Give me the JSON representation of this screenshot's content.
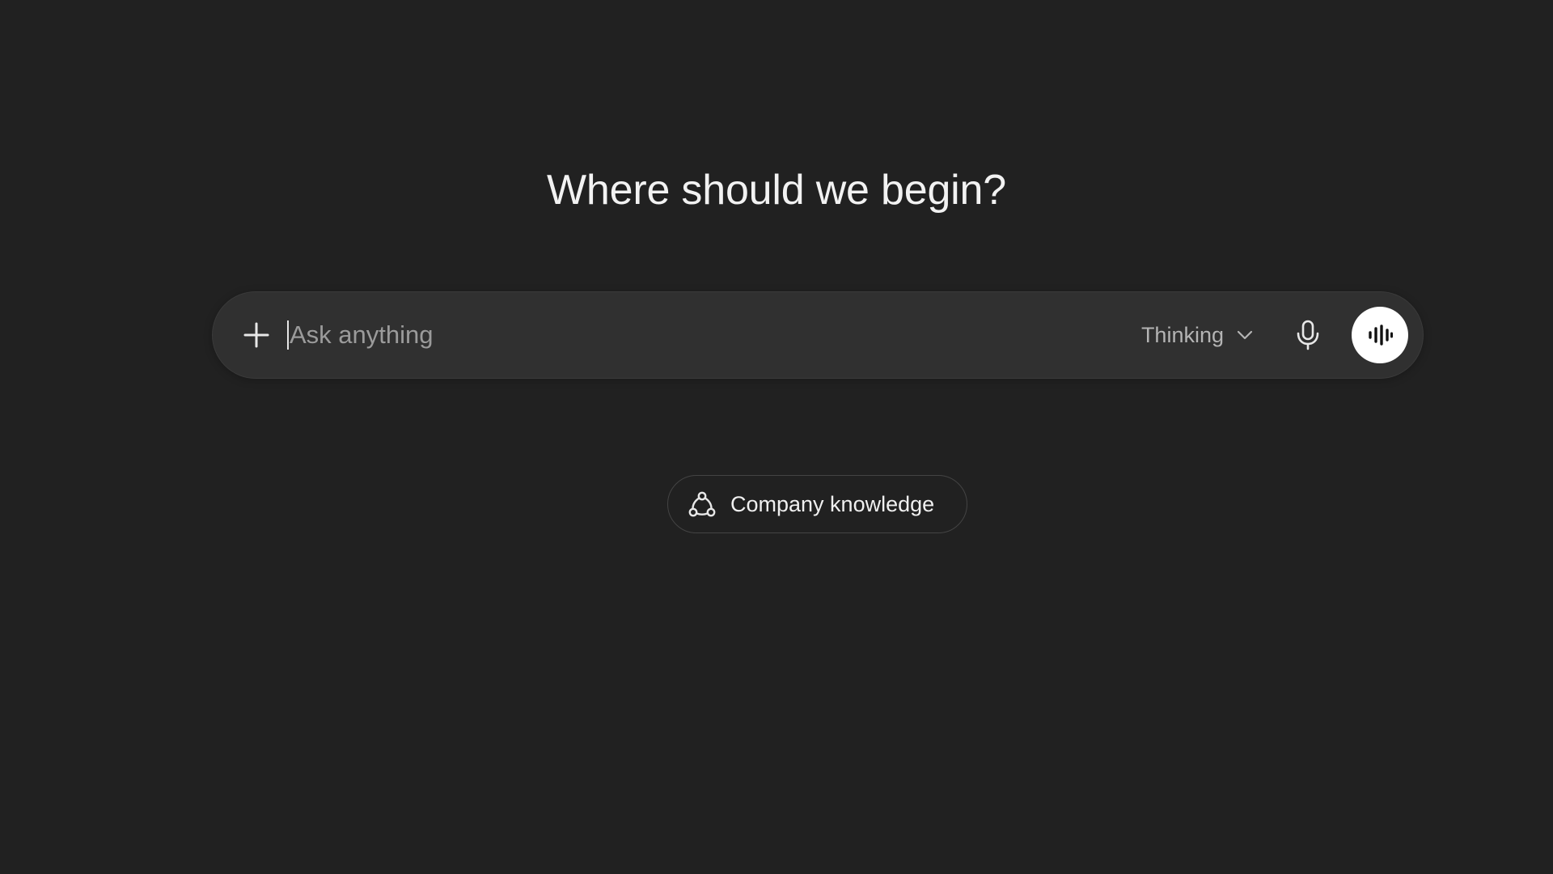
{
  "headline": "Where should we begin?",
  "composer": {
    "add_icon": "plus-icon",
    "placeholder": "Ask anything",
    "value": "",
    "model_label": "Thinking",
    "model_dropdown_icon": "chevron-down-icon",
    "mic_icon": "microphone-icon",
    "voice_icon": "voice-waveform-icon"
  },
  "chips": [
    {
      "label": "Company knowledge",
      "icon": "connected-nodes-icon"
    }
  ],
  "colors": {
    "background": "#212121",
    "composer_bg": "#303030",
    "voice_button_bg": "#ffffff",
    "text": "#ececec",
    "placeholder": "#9b9b9b"
  }
}
